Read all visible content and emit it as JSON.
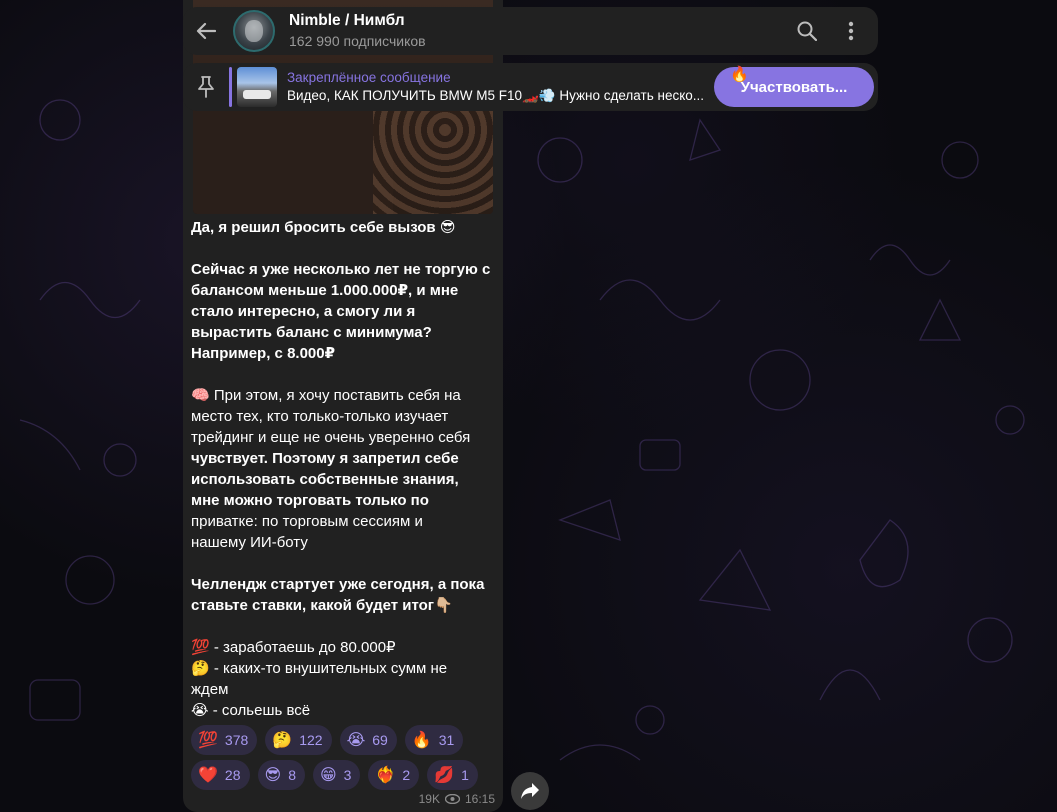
{
  "header": {
    "title": "Nimble / Нимбл",
    "subscribers": "162 990 подписчиков"
  },
  "pinned": {
    "label": "Закреплённое сообщение",
    "message": "Видео, КАК ПОЛУЧИТЬ BMW M5 F10🏎️💨 Нужно сделать неско...",
    "button_label": "Участвовать...",
    "button_emoji": "🔥"
  },
  "message": {
    "lines": [
      "Да, я решил бросить себе вызов 😎",
      "Сейчас я уже несколько лет не торгую с",
      "балансом меньше 1.000.000₽, и мне",
      "стало интересно, а смогу ли я",
      "вырастить баланс с минимума?",
      "Например, с 8.000₽",
      "🧠 При этом, я хочу поставить себя на",
      "место тех, кто только-только изучает",
      "трейдинг и еще не очень уверенно себя",
      "чувствует. Поэтому я запретил себе",
      "использовать собственные знания,",
      "мне можно торговать только по",
      "приватке: по торговым сессиям и",
      "нашему ИИ-боту",
      "Челлендж стартует уже сегодня, а пока",
      "ставьте ставки, какой будет итог👇🏼",
      "💯 - заработаешь до 80.000₽",
      "🤔 - каких-то внушительных сумм не",
      "ждем",
      "😭 - сольешь всё"
    ],
    "reactions_row1": [
      {
        "emoji": "💯",
        "count": "378"
      },
      {
        "emoji": "🤔",
        "count": "122"
      },
      {
        "emoji": "😭",
        "count": "69"
      },
      {
        "emoji": "🔥",
        "count": "31"
      }
    ],
    "reactions_row2": [
      {
        "emoji": "❤️",
        "count": "28"
      },
      {
        "emoji": "😎",
        "count": "8"
      },
      {
        "emoji": "😁",
        "count": "3"
      },
      {
        "emoji": "❤️‍🔥",
        "count": "2"
      },
      {
        "emoji": "💋",
        "count": "1"
      }
    ],
    "views": "19K",
    "time": "16:15"
  },
  "colors": {
    "accent": "#8774e1",
    "panel": "#212121",
    "reaction_bg": "#2f2b41"
  },
  "icons": [
    "back-arrow-icon",
    "search-icon",
    "more-vertical-icon",
    "pin-icon",
    "eye-icon",
    "share-icon"
  ]
}
